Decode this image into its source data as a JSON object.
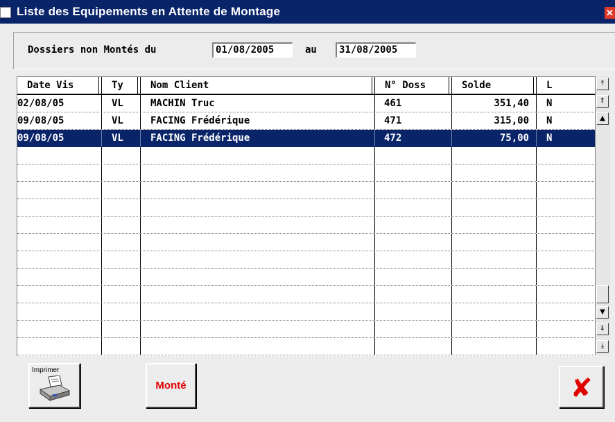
{
  "window": {
    "title": "Liste des Equipements en Attente de Montage",
    "close_glyph": "✕"
  },
  "filter": {
    "label": "Dossiers non Montés du",
    "between_label": "au",
    "date_from": "01/08/2005",
    "date_to": "31/08/2005"
  },
  "grid": {
    "columns": [
      "Date Vis",
      "Ty",
      "Nom Client",
      "N° Doss",
      "Solde",
      "L"
    ],
    "rows": [
      {
        "date": "02/08/05",
        "type": "VL",
        "client": "MACHIN Truc",
        "doss": "461",
        "solde": "351,40",
        "l": "N"
      },
      {
        "date": "09/08/05",
        "type": "VL",
        "client": "FACING Frédérique",
        "doss": "471",
        "solde": "315,00",
        "l": "N"
      },
      {
        "date": "09/08/05",
        "type": "VL",
        "client": "FACING Frédérique",
        "doss": "472",
        "solde": "75,00",
        "l": "N"
      }
    ],
    "selected_row": 2,
    "empty_rows": 12
  },
  "buttons": {
    "print_label": "Imprimer",
    "monte_label": "Monté",
    "close_glyph": "✘"
  },
  "icons": {
    "print": "printer-icon",
    "close": "close-icon",
    "scroll": [
      "scroll-top-icon",
      "scroll-page-up-icon",
      "scroll-up-icon",
      "scroll-down-icon",
      "scroll-page-down-icon",
      "scroll-bottom-icon"
    ]
  },
  "colors": {
    "titlebar": "#0a246a",
    "selection": "#0a246a",
    "accent_red": "#e00000"
  }
}
